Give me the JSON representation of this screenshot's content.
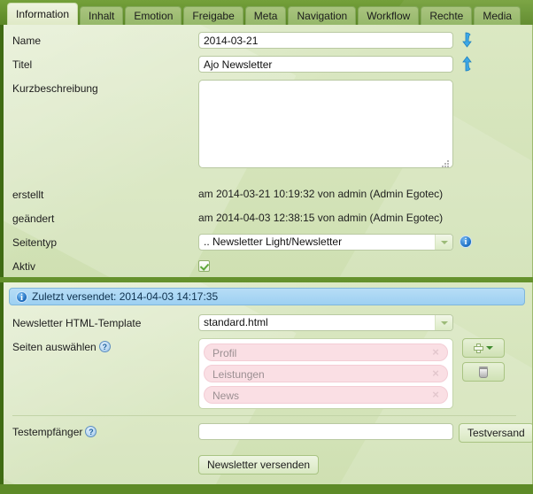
{
  "tabs": [
    {
      "label": "Information",
      "active": true
    },
    {
      "label": "Inhalt",
      "active": false
    },
    {
      "label": "Emotion",
      "active": false
    },
    {
      "label": "Freigabe",
      "active": false
    },
    {
      "label": "Meta",
      "active": false
    },
    {
      "label": "Navigation",
      "active": false
    },
    {
      "label": "Workflow",
      "active": false
    },
    {
      "label": "Rechte",
      "active": false
    },
    {
      "label": "Media",
      "active": false
    }
  ],
  "form": {
    "name": {
      "label": "Name",
      "value": "2014-03-21",
      "placeholder": "",
      "icon": "arrow-down-icon"
    },
    "titel": {
      "label": "Titel",
      "value": "Ajo Newsletter",
      "placeholder": "",
      "icon": "arrow-up-icon"
    },
    "kurzbeschreibung": {
      "label": "Kurzbeschreibung",
      "value": "",
      "placeholder": ""
    },
    "erstellt": {
      "label": "erstellt",
      "value": "am 2014-03-21 10:19:32 von admin (Admin Egotec)"
    },
    "geaendert": {
      "label": "geändert",
      "value": "am 2014-04-03 12:38:15 von admin (Admin Egotec)"
    },
    "seitentyp": {
      "label": "Seitentyp",
      "value": ".. Newsletter Light/Newsletter",
      "info_icon": "info-icon"
    },
    "aktiv": {
      "label": "Aktiv",
      "checked": true
    }
  },
  "newsletter": {
    "infobar": {
      "icon": "info-icon",
      "text": "Zuletzt versendet: 2014-04-03 14:17:35"
    },
    "template": {
      "label": "Newsletter HTML-Template",
      "value": "standard.html"
    },
    "seiten": {
      "label": "Seiten auswählen",
      "help": "?",
      "items": [
        {
          "label": "Profil",
          "remove": "×"
        },
        {
          "label": "Leistungen",
          "remove": "×"
        },
        {
          "label": "News",
          "remove": "×"
        }
      ],
      "add_button": "add-page-button",
      "delete_button": "delete-page-button"
    },
    "testempfaenger": {
      "label": "Testempfänger",
      "help": "?",
      "value": "",
      "placeholder": "",
      "button": "Testversand"
    },
    "send_button": "Newsletter versenden"
  },
  "colors": {
    "brand_green": "#5d8a27",
    "panel_bg": "#d6e4bb",
    "panel_border": "#3f6b13",
    "tab_inactive": "#96b86a",
    "tab_active": "#e3eccc",
    "info_blue": "#9dd0f2",
    "tag_pink": "#fadfe4",
    "accent_blue": "#1c6fc4"
  }
}
